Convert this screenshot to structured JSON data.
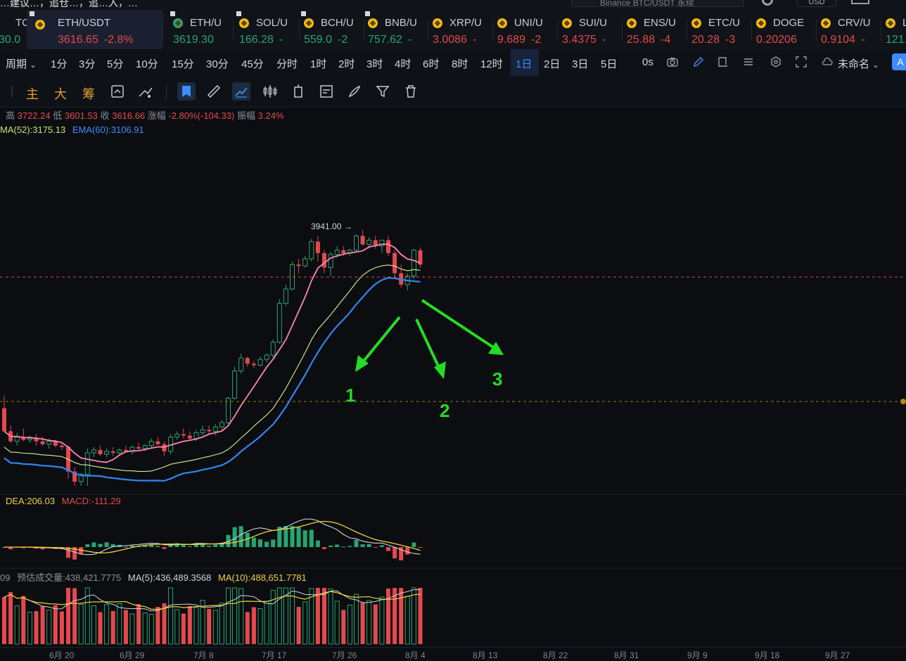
{
  "top": {
    "partial_text": "…建议…，追仓…，追…入，…",
    "search_placeholder": "Binance BTC/USDT 永续",
    "currency": "USD"
  },
  "tickers": [
    {
      "sym": "TC/U",
      "price": "30.0",
      "chg": "",
      "dir": "up",
      "pin": false,
      "coin": false,
      "x": 0
    },
    {
      "sym": "ETH/USDT",
      "price": "3616.65",
      "chg": "-2.8%",
      "dir": "down",
      "pin": true,
      "coin": true,
      "x": 38,
      "active": true
    },
    {
      "sym": "ETH/U",
      "price": "3619.30",
      "chg": "",
      "dir": "up",
      "pin": true,
      "coin": false,
      "x": 242
    },
    {
      "sym": "SOL/U",
      "price": "166.28",
      "chg": "-",
      "dir": "up",
      "pin": true,
      "coin": true,
      "x": 336
    },
    {
      "sym": "BCH/U",
      "price": "559.0",
      "chg": "-2",
      "dir": "up",
      "pin": true,
      "coin": true,
      "x": 428
    },
    {
      "sym": "BNB/U",
      "price": "757.62",
      "chg": "-",
      "dir": "up",
      "pin": true,
      "coin": true,
      "x": 519
    },
    {
      "sym": "XRP/U",
      "price": "3.0086",
      "chg": "-",
      "dir": "down",
      "pin": false,
      "coin": true,
      "x": 611
    },
    {
      "sym": "UNI/U",
      "price": "9.689",
      "chg": "-2",
      "dir": "down",
      "pin": false,
      "coin": true,
      "x": 703
    },
    {
      "sym": "SUI/U",
      "price": "3.4375",
      "chg": "-",
      "dir": "down",
      "pin": false,
      "coin": true,
      "x": 795
    },
    {
      "sym": "ENS/U",
      "price": "25.88",
      "chg": "-4",
      "dir": "down",
      "pin": false,
      "coin": true,
      "x": 887
    },
    {
      "sym": "ETC/U",
      "price": "20.28",
      "chg": "-3",
      "dir": "down",
      "pin": false,
      "coin": true,
      "x": 979
    },
    {
      "sym": "DOGE",
      "price": "0.20206",
      "chg": "",
      "dir": "down",
      "pin": false,
      "coin": true,
      "x": 1071
    },
    {
      "sym": "CRV/U",
      "price": "0.9104",
      "chg": "-",
      "dir": "down",
      "pin": false,
      "coin": true,
      "x": 1163
    },
    {
      "sym": "L",
      "price": "121.",
      "chg": "",
      "dir": "up",
      "pin": false,
      "coin": true,
      "x": 1255
    }
  ],
  "periods": {
    "label": "周期",
    "items": [
      "1分",
      "3分",
      "5分",
      "10分",
      "15分",
      "30分",
      "45分",
      "分时",
      "1时",
      "2时",
      "3时",
      "4时",
      "6时",
      "8时",
      "12时",
      "1日",
      "2日",
      "3日",
      "5日"
    ],
    "selected": "1日",
    "countdown": "0s",
    "layout_name": "未命名",
    "account": "A"
  },
  "tools": {
    "main": "主",
    "big": "大",
    "chip": "筹"
  },
  "ohlc": {
    "high_label": "高",
    "high": "3722.24",
    "low_label": "低",
    "low": "3601.53",
    "close_label": "收",
    "close": "3616.66",
    "chg_label": "涨幅",
    "chg": "-2.80%(-104.33)",
    "amp_label": "振幅",
    "amp": "3.24%"
  },
  "ma_line": "MA(52):3175.13",
  "ema_line": "EMA(60):3106.91",
  "high_marker": "3941.00 →",
  "annotations": [
    "1",
    "2",
    "3"
  ],
  "macd": {
    "dea": "DEA:206.03",
    "macd": "MACD:-111.29"
  },
  "volume": {
    "lead": "09",
    "est": "预估成交量:438,421.7775",
    "ma5": "MA(5):436,489.3568",
    "ma10": "MA(10):488,651.7781"
  },
  "xaxis": [
    "6月 20",
    "6月 29",
    "7月 8",
    "7月 17",
    "7月 26",
    "8月 4",
    "8月 13",
    "8月 22",
    "8月 31",
    "9月 9",
    "9月 18",
    "9月 27"
  ],
  "colors": {
    "up": "#25a572",
    "down": "#e5484d",
    "accent": "#3d8bff",
    "arrow": "#22dd22"
  },
  "chart_data": {
    "type": "candlestick",
    "candles": [
      [
        2700,
        2790,
        2650,
        2540
      ],
      [
        2540,
        2580,
        2460,
        2470
      ],
      [
        2470,
        2530,
        2440,
        2500
      ],
      [
        2500,
        2560,
        2470,
        2480
      ],
      [
        2480,
        2510,
        2460,
        2490
      ],
      [
        2490,
        2520,
        2440,
        2470
      ],
      [
        2470,
        2500,
        2440,
        2450
      ],
      [
        2450,
        2490,
        2420,
        2470
      ],
      [
        2470,
        2480,
        2430,
        2440
      ],
      [
        2440,
        2460,
        2410,
        2430
      ],
      [
        2430,
        2440,
        2210,
        2260
      ],
      [
        2260,
        2290,
        2160,
        2190
      ],
      [
        2190,
        2250,
        2160,
        2240
      ],
      [
        2240,
        2420,
        2160,
        2390
      ],
      [
        2390,
        2430,
        2360,
        2410
      ],
      [
        2410,
        2440,
        2370,
        2380
      ],
      [
        2380,
        2420,
        2360,
        2400
      ],
      [
        2400,
        2430,
        2370,
        2390
      ],
      [
        2390,
        2420,
        2370,
        2410
      ],
      [
        2410,
        2440,
        2390,
        2400
      ],
      [
        2400,
        2440,
        2380,
        2430
      ],
      [
        2430,
        2460,
        2400,
        2420
      ],
      [
        2420,
        2450,
        2400,
        2440
      ],
      [
        2440,
        2490,
        2420,
        2470
      ],
      [
        2470,
        2500,
        2440,
        2450
      ],
      [
        2450,
        2470,
        2370,
        2400
      ],
      [
        2400,
        2520,
        2380,
        2500
      ],
      [
        2500,
        2540,
        2480,
        2520
      ],
      [
        2520,
        2560,
        2490,
        2510
      ],
      [
        2510,
        2540,
        2480,
        2490
      ],
      [
        2490,
        2550,
        2470,
        2530
      ],
      [
        2530,
        2580,
        2510,
        2550
      ],
      [
        2550,
        2580,
        2520,
        2540
      ],
      [
        2540,
        2590,
        2510,
        2570
      ],
      [
        2570,
        2620,
        2550,
        2600
      ],
      [
        2600,
        2780,
        2590,
        2770
      ],
      [
        2770,
        2990,
        2760,
        2960
      ],
      [
        2960,
        3080,
        2940,
        3050
      ],
      [
        3050,
        3060,
        2990,
        3010
      ],
      [
        3010,
        3030,
        2980,
        3000
      ],
      [
        3000,
        3060,
        2990,
        3040
      ],
      [
        3040,
        3080,
        3020,
        3070
      ],
      [
        3070,
        3180,
        3050,
        3160
      ],
      [
        3160,
        3460,
        3150,
        3430
      ],
      [
        3430,
        3560,
        3410,
        3530
      ],
      [
        3530,
        3720,
        3520,
        3700
      ],
      [
        3700,
        3740,
        3640,
        3690
      ],
      [
        3690,
        3760,
        3680,
        3740
      ],
      [
        3740,
        3880,
        3720,
        3860
      ],
      [
        3860,
        3900,
        3720,
        3780
      ],
      [
        3780,
        3800,
        3640,
        3680
      ],
      [
        3680,
        3790,
        3620,
        3770
      ],
      [
        3770,
        3830,
        3750,
        3800
      ],
      [
        3800,
        3830,
        3760,
        3780
      ],
      [
        3780,
        3810,
        3760,
        3800
      ],
      [
        3800,
        3910,
        3790,
        3900
      ],
      [
        3900,
        3941,
        3830,
        3840
      ],
      [
        3840,
        3890,
        3810,
        3870
      ],
      [
        3870,
        3900,
        3810,
        3830
      ],
      [
        3830,
        3860,
        3780,
        3870
      ],
      [
        3870,
        3900,
        3760,
        3780
      ],
      [
        3780,
        3800,
        3600,
        3640
      ],
      [
        3640,
        3700,
        3540,
        3560
      ],
      [
        3560,
        3640,
        3520,
        3620
      ],
      [
        3620,
        3810,
        3600,
        3800
      ],
      [
        3800,
        3820,
        3680,
        3700
      ]
    ],
    "high": 3941.0,
    "series": [
      {
        "name": "MA(52)",
        "last": 3175.13
      },
      {
        "name": "EMA(60)",
        "last": 3106.91
      }
    ]
  }
}
